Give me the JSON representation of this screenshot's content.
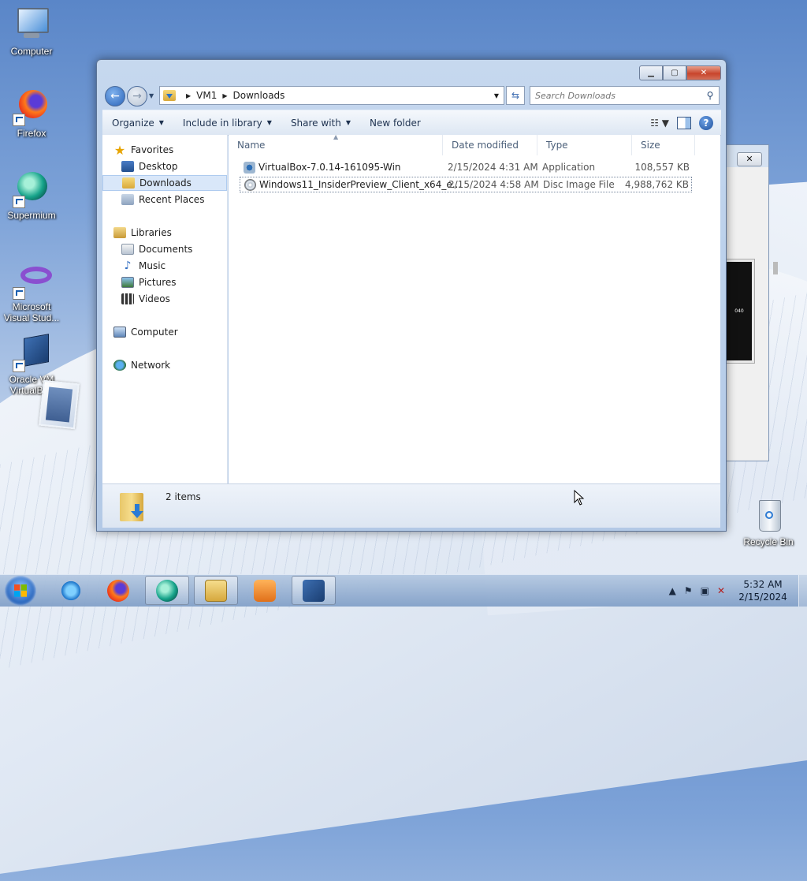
{
  "desktop": {
    "icons": [
      {
        "label": "Computer"
      },
      {
        "label": "Firefox"
      },
      {
        "label": "Supermium"
      },
      {
        "label_line1": "Microsoft",
        "label_line2": "Visual Stud..."
      },
      {
        "label_line1": "Oracle VM",
        "label_line2": "VirtualBox"
      },
      {
        "label": "Recycle Bin"
      }
    ]
  },
  "explorer": {
    "breadcrumb": [
      "VM1",
      "Downloads"
    ],
    "search_placeholder": "Search Downloads",
    "toolbar": {
      "organize": "Organize",
      "include_in_library": "Include in library",
      "share_with": "Share with",
      "new_folder": "New folder"
    },
    "nav": {
      "favorites": "Favorites",
      "desktop": "Desktop",
      "downloads": "Downloads",
      "recent_places": "Recent Places",
      "libraries": "Libraries",
      "documents": "Documents",
      "music": "Music",
      "pictures": "Pictures",
      "videos": "Videos",
      "computer": "Computer",
      "network": "Network"
    },
    "columns": {
      "name": "Name",
      "date_modified": "Date modified",
      "type": "Type",
      "size": "Size"
    },
    "files": [
      {
        "name": "VirtualBox-7.0.14-161095-Win",
        "date": "2/15/2024 4:31 AM",
        "type": "Application",
        "size": "108,557 KB"
      },
      {
        "name": "Windows11_InsiderPreview_Client_x64_e...",
        "date": "2/15/2024 4:58 AM",
        "type": "Disc Image File",
        "size": "4,988,762 KB"
      }
    ],
    "status_count": "2 items"
  },
  "background_window": {
    "screen_text": "040"
  },
  "taskbar": {
    "time": "5:32 AM",
    "date": "2/15/2024"
  },
  "icons": {
    "back": "back-arrow-icon",
    "forward": "forward-arrow-icon",
    "search": "magnifier-icon",
    "help": "help-icon"
  }
}
